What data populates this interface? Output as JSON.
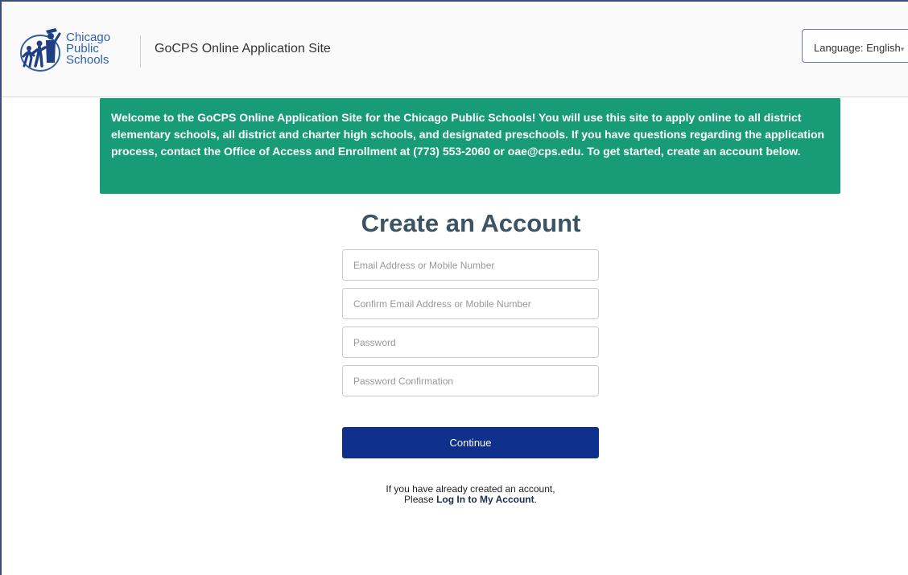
{
  "header": {
    "logo": {
      "line1": "Chicago",
      "line2": "Public",
      "line3": "Schools",
      "icon": "cps-logo-figures"
    },
    "site_title": "GoCPS Online Application Site",
    "language": {
      "label": "Language:",
      "selected": "English"
    }
  },
  "banner": {
    "text": "Welcome to the GoCPS Online Application Site for the Chicago Public Schools! You will use this site to apply online to all district elementary schools, all district and charter high schools, and designated preschools. If you have questions regarding the application process, contact the Office of Access and Enrollment at (773) 553-2060 or oae@cps.edu. To get started, create an account below."
  },
  "form": {
    "heading": "Create an Account",
    "fields": {
      "email_placeholder": "Email Address or Mobile Number",
      "confirm_email_placeholder": "Confirm Email Address or Mobile Number",
      "password_placeholder": "Password",
      "password_confirm_placeholder": "Password Confirmation"
    },
    "continue_label": "Continue",
    "login_note_line1": "If you have already created an account,",
    "login_note_prefix": "Please ",
    "login_link": "Log In to My Account",
    "login_note_suffix": "."
  },
  "colors": {
    "banner_bg": "#189c78",
    "button_bg": "#0f2f8c",
    "heading": "#3b5363",
    "logo_blue": "#2f5fa8"
  }
}
